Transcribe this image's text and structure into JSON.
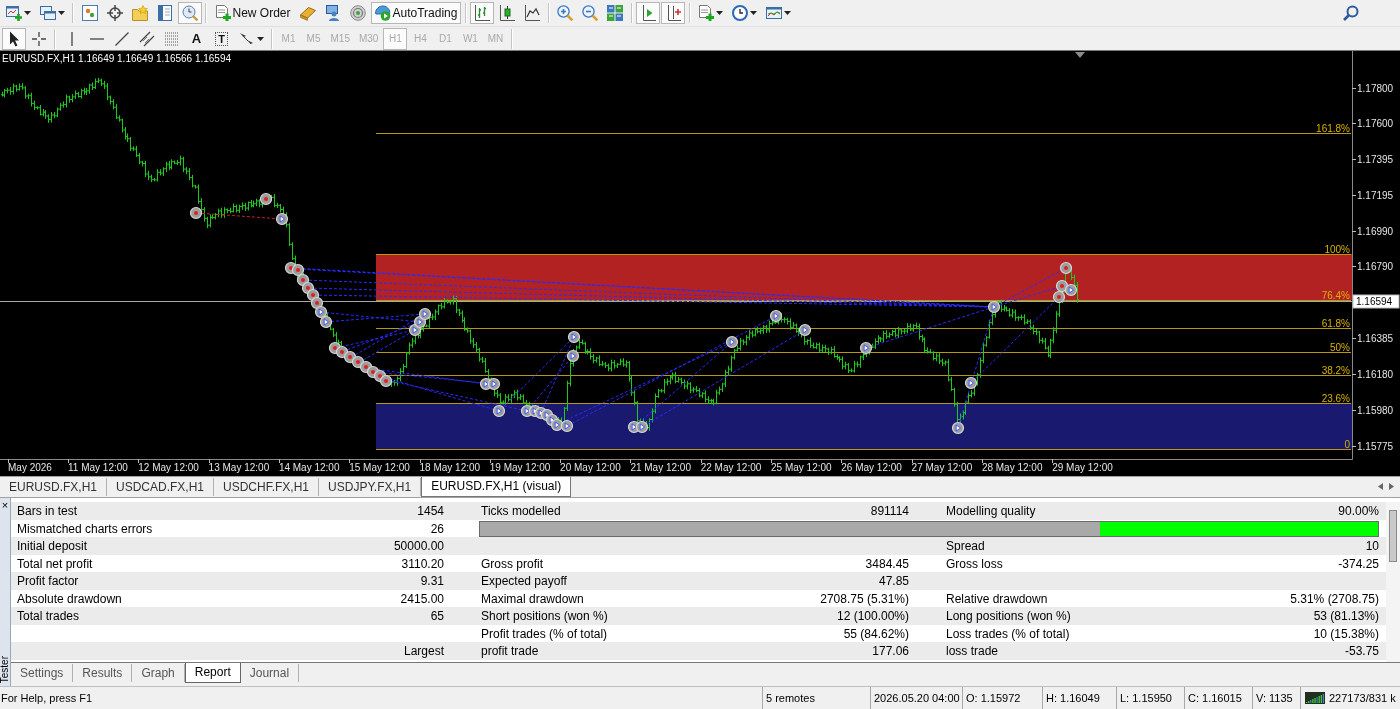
{
  "toolbar_main": [
    {
      "kind": "icon",
      "pressed": false,
      "dropdown": true
    },
    {
      "kind": "icon",
      "pressed": false,
      "dropdown": true
    },
    {
      "kind": "separator"
    },
    {
      "kind": "icon",
      "pressed": false,
      "dropdown": false
    },
    {
      "kind": "icon",
      "pressed": false,
      "dropdown": false
    },
    {
      "kind": "icon",
      "pressed": false,
      "dropdown": false
    },
    {
      "kind": "icon",
      "pressed": false,
      "dropdown": false
    },
    {
      "kind": "icon",
      "pressed": true,
      "dropdown": false
    },
    {
      "kind": "separator"
    },
    {
      "kind": "button",
      "label": "New Order",
      "pressed": false,
      "dropdown": false
    },
    {
      "kind": "icon",
      "pressed": false,
      "dropdown": false
    },
    {
      "kind": "icon",
      "pressed": false,
      "dropdown": false
    },
    {
      "kind": "icon",
      "pressed": false,
      "dropdown": false
    },
    {
      "kind": "button",
      "label": "AutoTrading",
      "pressed": true,
      "dropdown": false
    },
    {
      "kind": "separator"
    },
    {
      "kind": "icon",
      "pressed": true,
      "dropdown": false
    },
    {
      "kind": "icon",
      "pressed": false,
      "dropdown": false
    },
    {
      "kind": "icon",
      "pressed": false,
      "dropdown": false
    },
    {
      "kind": "separator"
    },
    {
      "kind": "icon",
      "pressed": false,
      "dropdown": false
    },
    {
      "kind": "icon",
      "pressed": false,
      "dropdown": false
    },
    {
      "kind": "icon",
      "pressed": false,
      "dropdown": false
    },
    {
      "kind": "separator"
    },
    {
      "kind": "icon",
      "pressed": true,
      "dropdown": false
    },
    {
      "kind": "icon",
      "pressed": true,
      "dropdown": false
    },
    {
      "kind": "separator"
    },
    {
      "kind": "icon",
      "pressed": false,
      "dropdown": true
    },
    {
      "kind": "icon",
      "pressed": false,
      "dropdown": true
    },
    {
      "kind": "icon",
      "pressed": false,
      "dropdown": true
    }
  ],
  "toolbar_drawing": [
    {
      "kind": "icon",
      "pressed": true,
      "dropdown": false
    },
    {
      "kind": "icon",
      "pressed": false,
      "dropdown": false
    },
    {
      "kind": "separator"
    },
    {
      "kind": "icon",
      "pressed": false,
      "dropdown": false
    },
    {
      "kind": "icon",
      "pressed": false,
      "dropdown": false
    },
    {
      "kind": "icon",
      "pressed": false,
      "dropdown": false
    },
    {
      "kind": "icon",
      "pressed": false,
      "dropdown": false
    },
    {
      "kind": "icon",
      "pressed": false,
      "dropdown": false
    },
    {
      "kind": "glyph",
      "label": "A",
      "pressed": false
    },
    {
      "kind": "boxed_glyph",
      "label": "T",
      "pressed": false
    },
    {
      "kind": "icon",
      "pressed": false,
      "dropdown": true
    },
    {
      "kind": "separator"
    },
    {
      "kind": "period",
      "label": "M1",
      "selected": false,
      "disabled": true
    },
    {
      "kind": "period",
      "label": "M5",
      "selected": false,
      "disabled": true
    },
    {
      "kind": "period",
      "label": "M15",
      "selected": false,
      "disabled": true
    },
    {
      "kind": "period",
      "label": "M30",
      "selected": false,
      "disabled": true
    },
    {
      "kind": "period",
      "label": "H1",
      "selected": true,
      "disabled": true
    },
    {
      "kind": "period",
      "label": "H4",
      "selected": false,
      "disabled": true
    },
    {
      "kind": "period",
      "label": "D1",
      "selected": false,
      "disabled": true
    },
    {
      "kind": "period",
      "label": "W1",
      "selected": false,
      "disabled": true
    },
    {
      "kind": "period",
      "label": "MN",
      "selected": false,
      "disabled": true
    },
    {
      "kind": "separator"
    }
  ],
  "chart": {
    "title": "EURUSD.FX,H1 1.16649 1.16649 1.16566 1.16594",
    "price_ticks": [
      "1.17800",
      "1.17600",
      "1.17395",
      "1.17195",
      "1.16990",
      "1.16790",
      "1.16385",
      "1.16180",
      "1.15980",
      "1.15775"
    ],
    "current_price": "1.16594",
    "time_labels": [
      "May 2026",
      "11 May 12:00",
      "12 May 12:00",
      "13 May 12:00",
      "14 May 12:00",
      "15 May 12:00",
      "18 May 12:00",
      "19 May 12:00",
      "20 May 12:00",
      "21 May 12:00",
      "22 May 12:00",
      "25 May 12:00",
      "26 May 12:00",
      "27 May 12:00",
      "28 May 12:00",
      "29 May 12:00"
    ],
    "fibonacci_levels": [
      "161.8%",
      "100%",
      "76.4%",
      "61.8%",
      "50%",
      "38.2%",
      "23.6%",
      "0"
    ]
  },
  "chart_tabs": [
    {
      "label": "EURUSD.FX,H1",
      "selected": false
    },
    {
      "label": "USDCAD.FX,H1",
      "selected": false
    },
    {
      "label": "USDCHF.FX,H1",
      "selected": false
    },
    {
      "label": "USDJPY.FX,H1",
      "selected": false
    },
    {
      "label": "EURUSD.FX,H1 (visual)",
      "selected": true
    }
  ],
  "tester": {
    "close": "×",
    "title": "Tester"
  },
  "report": {
    "rows": [
      {
        "left": {
          "label": "Bars in test",
          "value": "1454"
        },
        "middle": {
          "label": "Ticks modelled",
          "value": "891114"
        },
        "right": {
          "label": "Modelling quality",
          "value": "90.00%"
        }
      },
      {
        "left": {
          "label": "Mismatched charts errors",
          "value": "26"
        },
        "quality_bar": {
          "level": 0.31
        }
      },
      {
        "left": {
          "label": "Initial deposit",
          "value": "50000.00"
        },
        "right": {
          "label": "Spread",
          "value": "10"
        }
      },
      {
        "left": {
          "label": "Total net profit",
          "value": "3110.20"
        },
        "middle": {
          "label": "Gross profit",
          "value": "3484.45"
        },
        "right": {
          "label": "Gross loss",
          "value": "-374.25"
        }
      },
      {
        "left": {
          "label": "Profit factor",
          "value": "9.31"
        },
        "middle": {
          "label": "Expected payoff",
          "value": "47.85"
        }
      },
      {
        "left": {
          "label": "Absolute drawdown",
          "value": "2415.00"
        },
        "middle": {
          "label": "Maximal drawdown",
          "value": "2708.75 (5.31%)"
        },
        "right": {
          "label": "Relative drawdown",
          "value": "5.31% (2708.75)"
        }
      },
      {
        "left": {
          "label": "Total trades",
          "value": "65"
        },
        "middle": {
          "label": "Short positions (won %)",
          "value": "12 (100.00%)"
        },
        "right": {
          "label": "Long positions (won %)",
          "value": "53 (81.13%)"
        }
      },
      {
        "middle": {
          "label": "Profit trades (% of total)",
          "value": "55 (84.62%)"
        },
        "right": {
          "label": "Loss trades (% of total)",
          "value": "10 (15.38%)"
        }
      },
      {
        "left": {
          "value": "Largest"
        },
        "middle": {
          "label": "profit trade",
          "value": "177.06"
        },
        "right": {
          "label": "loss trade",
          "value": "-53.75"
        }
      }
    ]
  },
  "tester_tabs": [
    {
      "label": "Settings",
      "selected": false
    },
    {
      "label": "Results",
      "selected": false
    },
    {
      "label": "Graph",
      "selected": false
    },
    {
      "label": "Report",
      "selected": true
    },
    {
      "label": "Journal",
      "selected": false
    }
  ],
  "status_bar": {
    "help": "For Help, press F1",
    "fields": [
      "5 remotes",
      "2026.05.20 04:00",
      "O: 1.15972",
      "H: 1.16049",
      "L: 1.15950",
      "C: 1.16015",
      "V: 1135"
    ],
    "traffic": "227173/831 k"
  }
}
